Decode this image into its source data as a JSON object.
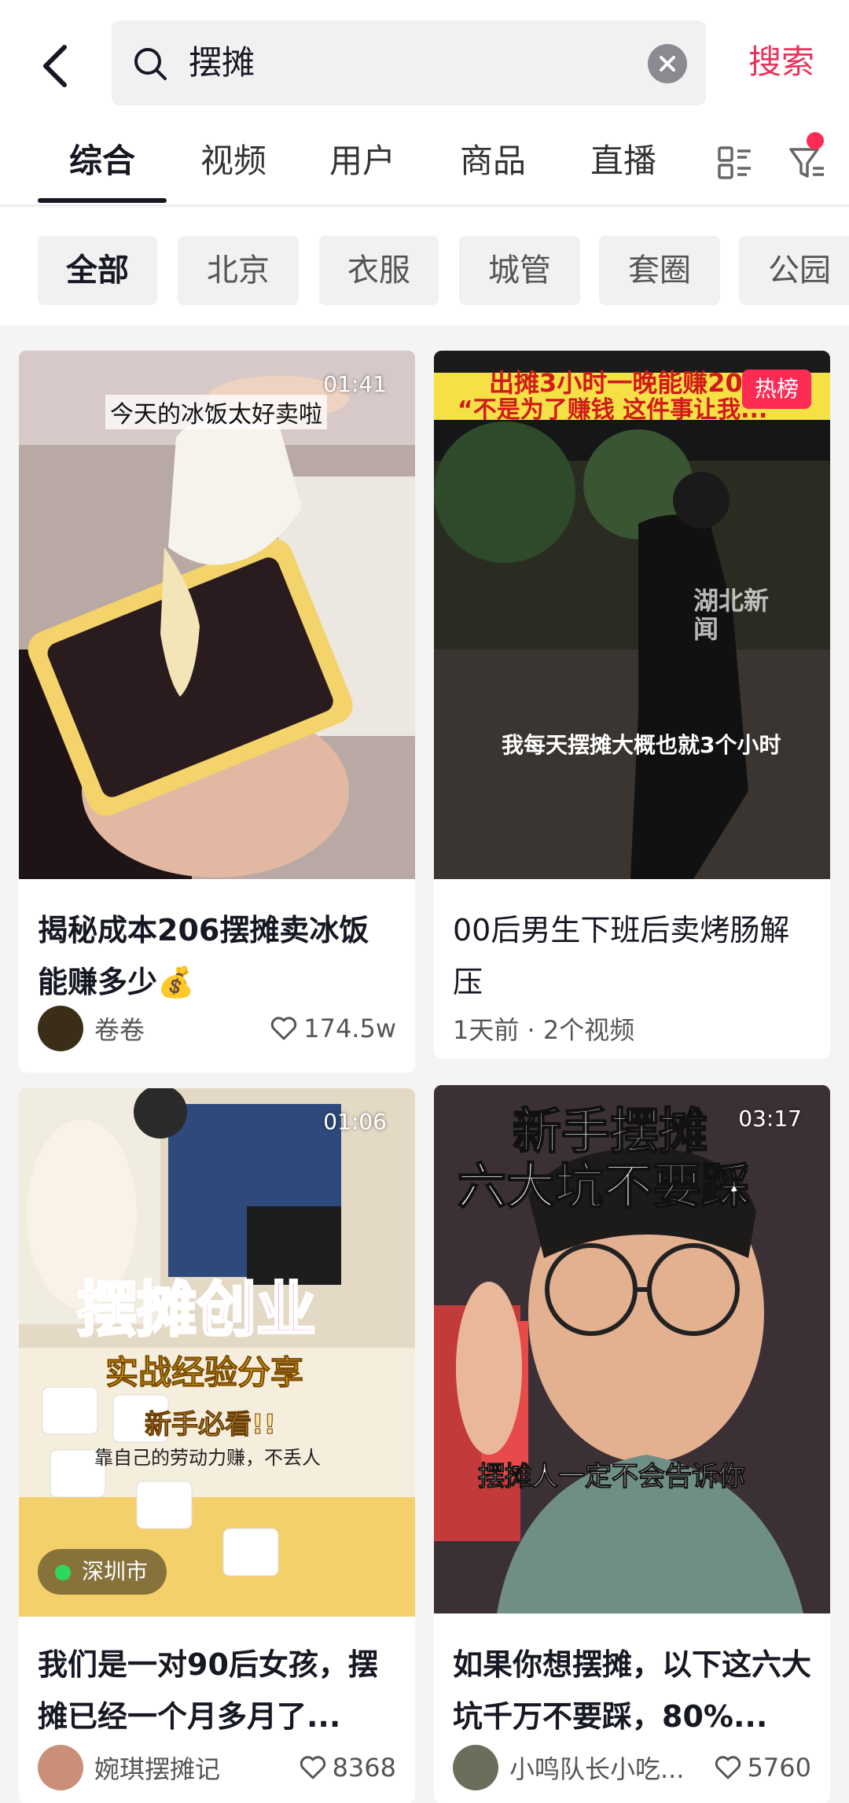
{
  "search": {
    "query": "摆摊",
    "button_label": "搜索"
  },
  "tabs": [
    {
      "label": "综合",
      "active": true
    },
    {
      "label": "视频"
    },
    {
      "label": "用户"
    },
    {
      "label": "商品"
    },
    {
      "label": "直播"
    }
  ],
  "chips": [
    {
      "label": "全部",
      "active": true
    },
    {
      "label": "北京"
    },
    {
      "label": "衣服"
    },
    {
      "label": "城管"
    },
    {
      "label": "套圈"
    },
    {
      "label": "公园"
    }
  ],
  "cards": [
    {
      "duration": "01:41",
      "overlay": "今天的冰饭太好卖啦",
      "title": "揭秘成本206摆摊卖冰饭能赚多少💰",
      "author": "卷卷",
      "likes": "174.5w"
    },
    {
      "badge": "热榜",
      "overlay_top1": "出摊3小时一晚能赚200元",
      "overlay_top2": "“不是为了赚钱 这件事让我...”",
      "overlay_bottom": "我每天摆摊大概也就3个小时",
      "watermark": "湖北新闻",
      "title": "00后男生下班后卖烤肠解压",
      "meta": "1天前 · 2个视频"
    },
    {
      "duration": "01:06",
      "overlay_big": "摆摊创业",
      "overlay_mid": "实战经验分享",
      "overlay_small": "新手必看!!",
      "overlay_line": "靠自己的劳动力赚，不丢人",
      "location": "深圳市",
      "title": "我们是一对90后女孩，摆摊已经一个月多月了...",
      "author": "婉琪摆摊记",
      "likes": "8368"
    },
    {
      "duration": "03:17",
      "overlay_top1": "新手摆摊",
      "overlay_top2": "六大坑不要踩",
      "overlay_bottom": "摆摊人一定不会告诉你",
      "title": "如果你想摆摊，以下这六大坑千万不要踩，80%...",
      "author": "小鸣队长小吃...",
      "likes": "5760"
    }
  ],
  "colors": {
    "accent": "#e8345a",
    "hot_badge": "#fe2c55",
    "text": "#161823"
  }
}
